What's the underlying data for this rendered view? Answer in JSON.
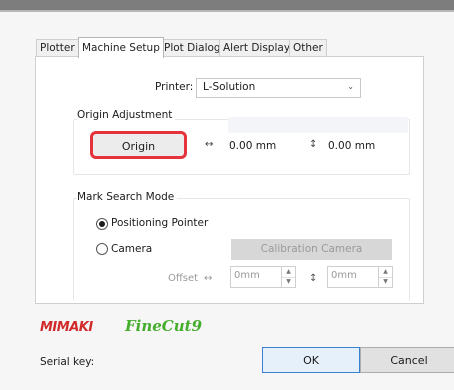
{
  "tabs": [
    "Plotter",
    "Machine Setup",
    "Plot Dialog",
    "Alert Display",
    "Other"
  ],
  "active_tab": "Machine Setup",
  "printer": {
    "label": "Printer:",
    "value": "L-Solution"
  },
  "origin_adjustment": {
    "title": "Origin Adjustment",
    "button_label": "Origin",
    "horizontal_value": "0.00 mm",
    "vertical_value": "0.00 mm"
  },
  "mark_search": {
    "title": "Mark Search Mode",
    "option_positioning": "Positioning Pointer",
    "option_camera": "Camera",
    "calibration_button": "Calibration Camera",
    "offset_label": "Offset",
    "offset_x": "0mm",
    "offset_y": "0mm",
    "selected": "Positioning Pointer"
  },
  "brand": {
    "mimaki": "MIMAKI",
    "finecut": "FineCut9"
  },
  "footer": {
    "serial_label": "Serial key:",
    "ok_label": "OK",
    "cancel_label": "Cancel"
  },
  "colors": {
    "origin_highlight": "#e5323c",
    "mimaki_red": "#d12a2a",
    "finecut_green": "#45ad2c"
  },
  "icons": {
    "horizontal_arrow": "↔",
    "vertical_arrow": "↕"
  }
}
